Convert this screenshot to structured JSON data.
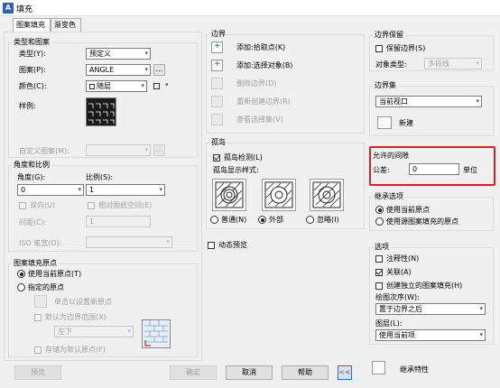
{
  "window": {
    "title": "填充"
  },
  "tabs": [
    "图案填充",
    "渐变色"
  ],
  "type_pattern": {
    "header": "类型和图案",
    "type_label": "类型(Y):",
    "type_value": "预定义",
    "pattern_label": "图案(P):",
    "pattern_value": "ANGLE",
    "color_label": "颜色(C):",
    "color_value": "随层",
    "swatch_label": "样例:",
    "custom_label": "自定义图案(M):",
    "more_btn": "..."
  },
  "angle_scale": {
    "header": "角度和比例",
    "angle_label": "角度(G):",
    "angle_value": "0",
    "scale_label": "比例(S):",
    "scale_value": "1",
    "double_label": "双向(U)",
    "relative_label": "相对图纸空间(E)",
    "spacing_label": "间距(C):",
    "spacing_value": "1",
    "iso_label": "ISO 笔宽(O):"
  },
  "origin": {
    "header": "图案填充原点",
    "use_current": "使用当前原点(T)",
    "specified": "指定的原点",
    "click_set": "单击以设置新原点",
    "default_boundary": "默认为边界范围(X)",
    "position_value": "左下",
    "store_default": "存储为默认原点(F)"
  },
  "boundary": {
    "header": "边界",
    "add_pick": "添加:拾取点(K)",
    "add_select": "添加:选择对象(B)",
    "remove": "删除边界(D)",
    "recreate": "重新创建边界(R)",
    "view_selection": "查看选择集(V)"
  },
  "islands": {
    "header": "孤岛",
    "detect_label": "孤岛检测(L)",
    "style_label": "孤岛显示样式:",
    "normal": "普通(N)",
    "outer": "外部",
    "ignore": "忽略(I)"
  },
  "dynamic_preview": "动态预览",
  "boundary_keep": {
    "header": "边界保留",
    "keep_label": "保留边界(S)",
    "object_type_label": "对象类型:",
    "object_type_value": "多段线"
  },
  "boundary_set": {
    "header": "边界集",
    "value": "当前视口",
    "new_label": "新建"
  },
  "gap": {
    "header": "允许的间隙",
    "tolerance_label": "公差:",
    "tolerance_value": "0",
    "unit": "单位"
  },
  "inherit": {
    "header": "继承选项",
    "use_current": "使用当前原点",
    "use_source": "使用源图案填充的原点"
  },
  "options": {
    "header": "选项",
    "annotative": "注释性(N)",
    "associative": "关联(A)",
    "separate": "创建独立的图案填充(H)",
    "draw_order_label": "绘图次序(W):",
    "draw_order_value": "置于边界之后",
    "layer_label": "图层(L):",
    "layer_value": "使用当前项"
  },
  "buttons": {
    "preview": "预览",
    "ok": "确定",
    "cancel": "取消",
    "help": "帮助",
    "collapse": "<<",
    "inherit": "继承特性"
  }
}
